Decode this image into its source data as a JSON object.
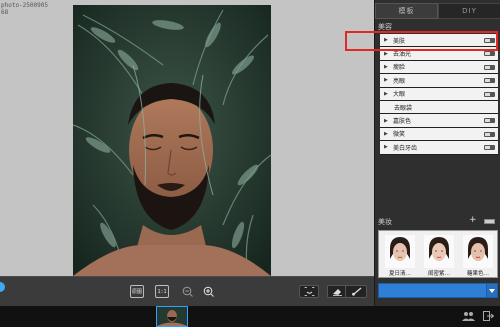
{
  "file_info": {
    "line1": "photo-2500905",
    "line2": "68"
  },
  "toolbar": {
    "btn_original": "原图",
    "btn_fit": "1:1"
  },
  "panel": {
    "tabs": [
      {
        "label": "模板"
      },
      {
        "label": "DIY"
      }
    ],
    "section_title": "美容",
    "items": [
      {
        "label": "美肤",
        "has_arrow": true
      },
      {
        "label": "去油光",
        "has_arrow": true
      },
      {
        "label": "瘦脸",
        "has_arrow": true
      },
      {
        "label": "亮眼",
        "has_arrow": true
      },
      {
        "label": "大眼",
        "has_arrow": true
      },
      {
        "label": "去眼袋",
        "has_arrow": false
      },
      {
        "label": "嘉肤色",
        "has_arrow": true
      },
      {
        "label": "微笑",
        "has_arrow": true
      },
      {
        "label": "美白牙齿",
        "has_arrow": true
      }
    ],
    "makeup_title": "美妆",
    "makeup_plus": "+",
    "makeup_presets": [
      {
        "label": "夏日清…"
      },
      {
        "label": "闺密紫…"
      },
      {
        "label": "糖果色…"
      }
    ]
  },
  "colors": {
    "accent": "#2f7fd6",
    "highlight": "#e32626",
    "selection": "#32a0ff"
  }
}
